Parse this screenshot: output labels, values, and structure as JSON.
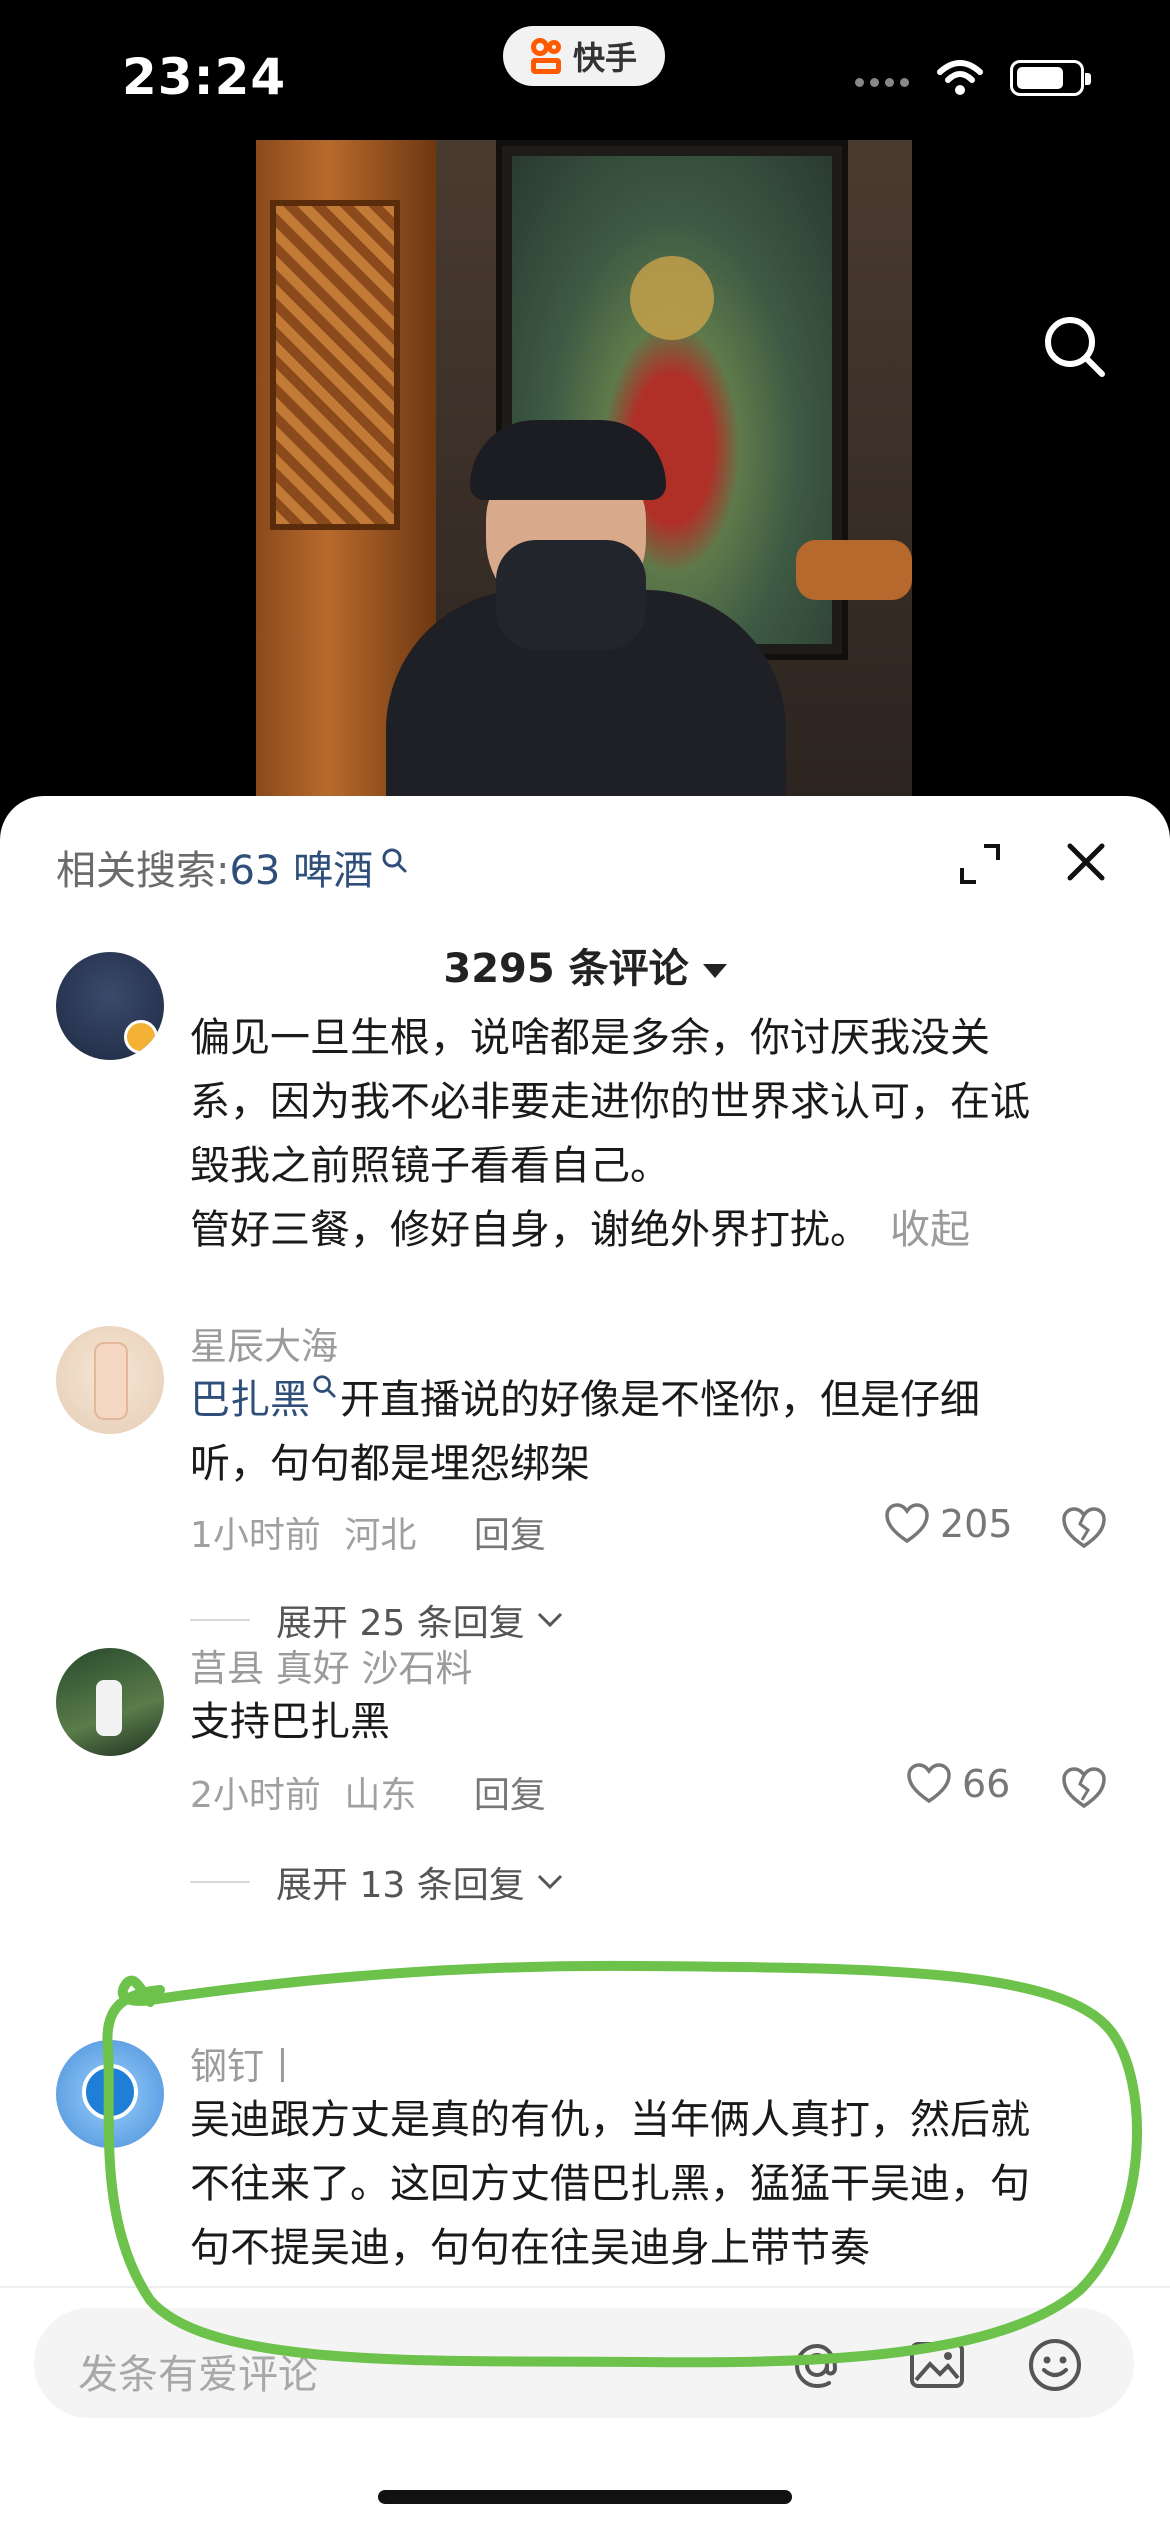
{
  "status_bar": {
    "time": "23:24",
    "app_name": "快手"
  },
  "related_search": {
    "label": "相关搜索:",
    "keyword": "63 啤酒"
  },
  "comments_header": {
    "count_label": "3295 条评论"
  },
  "comments": [
    {
      "text_lines": [
        "偏见一旦生根，说啥都是多余，你讨厌我没关",
        "系，因为我不必非要走进你的世界求认可，在诋",
        "毁我之前照镜子看看自己。",
        "管好三餐，修好自身，谢绝外界打扰。"
      ],
      "collapse_label": "收起"
    },
    {
      "user": "星辰大海",
      "mention": "巴扎黑",
      "text_line1": "开直播说的好像是不怪你，但是仔细",
      "text_line2": "听，句句都是埋怨绑架",
      "time": "1小时前",
      "location": "河北",
      "reply_label": "回复",
      "likes": "205",
      "expand_label": "展开 25 条回复"
    },
    {
      "user": "莒县 真好 沙石料",
      "text": "支持巴扎黑",
      "time": "2小时前",
      "location": "山东",
      "reply_label": "回复",
      "likes": "66",
      "expand_label": "展开 13 条回复"
    },
    {
      "user": "钢钉丨",
      "text_lines": [
        "吴迪跟方丈是真的有仇，当年俩人真打，然后就",
        "不往来了。这回方丈借巴扎黑，猛猛干吴迪，句",
        "句不提吴迪，句句在往吴迪身上带节奏"
      ]
    }
  ],
  "input": {
    "placeholder": "发条有爱评论"
  },
  "icons": [
    "search-icon",
    "expand-icon",
    "close-icon",
    "heart-icon",
    "broken-heart-icon",
    "chevron-down-icon",
    "at-icon",
    "image-icon",
    "emoji-icon"
  ],
  "colors": {
    "accent_link": "#2f4f7a",
    "annotation": "#6cc24a",
    "brand": "#ff5a00"
  }
}
